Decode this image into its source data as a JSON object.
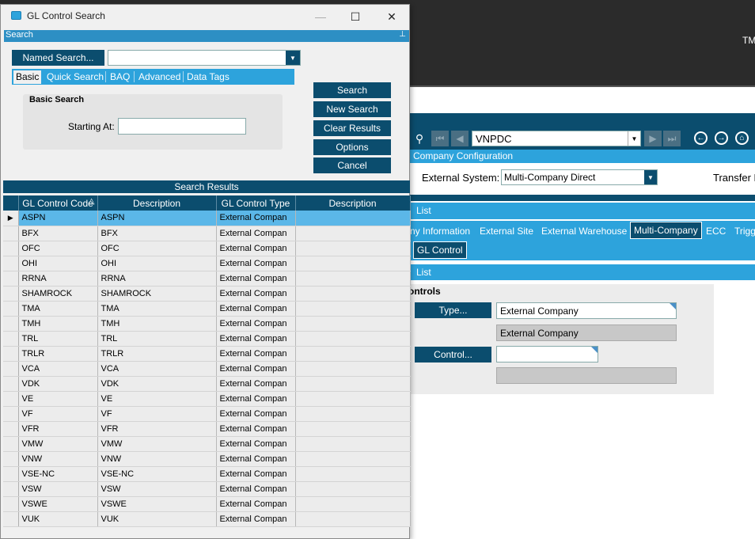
{
  "background_app": {
    "tm_text": "TM",
    "company_value": "VNPDC",
    "company_config_label": "Company Configuration",
    "external_system_label": "External System:",
    "external_system_value": "Multi-Company Direct",
    "transfer_label": "Transfer M",
    "list_label_1": "List",
    "tabs": [
      "ny Information",
      "External Site",
      "External Warehouse",
      "ECC",
      "Trigg"
    ],
    "active_tab": "Multi-Company",
    "subtab_active": "GL Control",
    "list_label_2": "List",
    "controls_title": "ontrols",
    "type_button": "Type...",
    "type_value": "External Company",
    "type_desc": "External Company",
    "control_button": "Control...",
    "control_value": "",
    "control_desc": ""
  },
  "dialog": {
    "title": "GL Control Search",
    "search_header": "Search",
    "named_search_button": "Named Search...",
    "named_search_value": "",
    "search_tabs": [
      "Basic",
      "Quick Search",
      "BAQ",
      "Advanced",
      "Data Tags"
    ],
    "basic_search_title": "Basic Search",
    "starting_at_label": "Starting At:",
    "starting_at_value": "",
    "buttons": {
      "search": "Search",
      "new_search": "New Search",
      "clear_results": "Clear Results",
      "options": "Options",
      "cancel": "Cancel"
    },
    "results_header": "Search Results",
    "columns": [
      "GL Control Code",
      "Description",
      "GL Control Type",
      "Description"
    ],
    "rows": [
      [
        "ASPN",
        "ASPN",
        "External Compan",
        ""
      ],
      [
        "BFX",
        "BFX",
        "External Compan",
        ""
      ],
      [
        "OFC",
        "OFC",
        "External Compan",
        ""
      ],
      [
        "OHI",
        "OHI",
        "External Compan",
        ""
      ],
      [
        "RRNA",
        "RRNA",
        "External Compan",
        ""
      ],
      [
        "SHAMROCK",
        "SHAMROCK",
        "External Compan",
        ""
      ],
      [
        "TMA",
        "TMA",
        "External Compan",
        ""
      ],
      [
        "TMH",
        "TMH",
        "External Compan",
        ""
      ],
      [
        "TRL",
        "TRL",
        "External Compan",
        ""
      ],
      [
        "TRLR",
        "TRLR",
        "External Compan",
        ""
      ],
      [
        "VCA",
        "VCA",
        "External Compan",
        ""
      ],
      [
        "VDK",
        "VDK",
        "External Compan",
        ""
      ],
      [
        "VE",
        "VE",
        "External Compan",
        ""
      ],
      [
        "VF",
        "VF",
        "External Compan",
        ""
      ],
      [
        "VFR",
        "VFR",
        "External Compan",
        ""
      ],
      [
        "VMW",
        "VMW",
        "External Compan",
        ""
      ],
      [
        "VNW",
        "VNW",
        "External Compan",
        ""
      ],
      [
        "VSE-NC",
        "VSE-NC",
        "External Compan",
        ""
      ],
      [
        "VSW",
        "VSW",
        "External Compan",
        ""
      ],
      [
        "VSWE",
        "VSWE",
        "External Compan",
        ""
      ],
      [
        "VUK",
        "VUK",
        "External Compan",
        ""
      ]
    ]
  },
  "colors": {
    "navy": "#0b4d6e",
    "accent_blue": "#2da3dc",
    "selected_row": "#5bb7e8"
  }
}
